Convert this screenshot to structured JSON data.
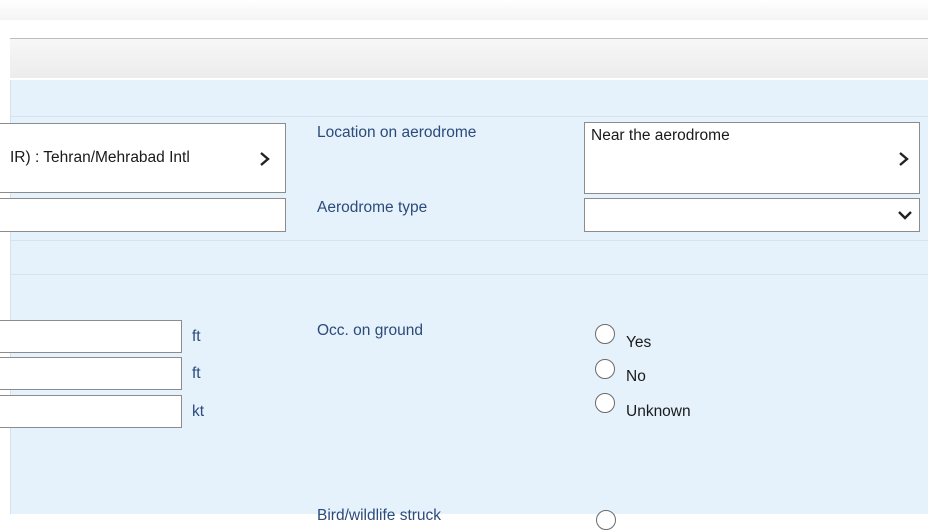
{
  "aerodrome": {
    "value": "IR) : Tehran/Mehrabad Intl",
    "location_label": "Location on aerodrome",
    "location_value": "Near the aerodrome",
    "type_label": "Aerodrome type",
    "type_value": "",
    "name_field_value": ""
  },
  "flight": {
    "field1_value": "",
    "field1_unit": "ft",
    "field2_value": "",
    "field2_unit": "ft",
    "field3_value": "",
    "field3_unit": "kt"
  },
  "occ_on_ground": {
    "label": "Occ. on ground",
    "options": [
      "Yes",
      "No",
      "Unknown"
    ]
  },
  "cut_off": {
    "label": "Bird/wildlife struck"
  },
  "icons": {
    "chevron_right": "chevron-right-icon",
    "chevron_down": "chevron-down-icon"
  },
  "colors": {
    "panel_bg": "#e5f1fb",
    "label_text": "#2b4b7a"
  }
}
